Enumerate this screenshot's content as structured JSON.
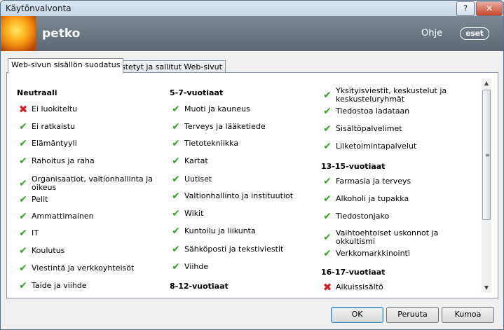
{
  "window": {
    "title": "Käytönvalvonta",
    "help_label": "?",
    "close_label": "✕"
  },
  "header": {
    "user": "petko",
    "help_link": "Ohje",
    "logo_text": "eset"
  },
  "tabs": [
    {
      "label": "Web-sivun sisällön suodatus",
      "active": true
    },
    {
      "label": "Estetyt ja sallitut Web-sivut",
      "active": false
    }
  ],
  "columns": [
    {
      "heading": "Neutraali",
      "items": [
        {
          "label": "Ei luokiteltu",
          "allowed": false
        },
        {
          "label": "Ei ratkaistu",
          "allowed": true
        },
        {
          "label": "Elämäntyyli",
          "allowed": true
        },
        {
          "label": "Rahoitus ja raha",
          "allowed": true
        },
        {
          "label": "Organisaatiot, valtionhallinta ja oikeus",
          "allowed": true
        },
        {
          "label": "Pelit",
          "allowed": true
        },
        {
          "label": "Ammattimainen",
          "allowed": true
        },
        {
          "label": "IT",
          "allowed": true
        },
        {
          "label": "Koulutus",
          "allowed": true
        },
        {
          "label": "Viestintä ja verkkoyhteisöt",
          "allowed": true
        },
        {
          "label": "Taide ja viihde",
          "allowed": true
        }
      ]
    },
    {
      "heading": "5-7-vuotiaat",
      "items": [
        {
          "label": "Muoti ja kauneus",
          "allowed": true
        },
        {
          "label": "Terveys ja lääketiede",
          "allowed": true
        },
        {
          "label": "Tietotekniikka",
          "allowed": true
        },
        {
          "label": "Kartat",
          "allowed": true
        },
        {
          "label": "Uutiset",
          "allowed": true
        },
        {
          "label": "Valtionhallinto ja instituutiot",
          "allowed": true
        },
        {
          "label": "Wikit",
          "allowed": true
        },
        {
          "label": "Kuntoilu ja liikunta",
          "allowed": true
        },
        {
          "label": "Sähköposti ja tekstiviestit",
          "allowed": true
        },
        {
          "label": "Viihde",
          "allowed": true
        }
      ],
      "heading2": "8-12-vuotiaat"
    },
    {
      "items": [
        {
          "label": "Yksityisviestit, keskustelut ja keskusteluryhmät",
          "allowed": true
        },
        {
          "label": "Tiedostoa ladataan",
          "allowed": true
        },
        {
          "label": "Sisältöpalvelimet",
          "allowed": true
        },
        {
          "label": "Liiketoimintapalvelut",
          "allowed": true
        }
      ],
      "heading2": "13-15-vuotiaat",
      "items2": [
        {
          "label": "Farmasia ja terveys",
          "allowed": true
        },
        {
          "label": "Alkoholi ja tupakka",
          "allowed": true
        },
        {
          "label": "Tiedostonjako",
          "allowed": true
        },
        {
          "label": "Vaihtoehtoiset uskonnot ja okkultismi",
          "allowed": true
        },
        {
          "label": "Verkkomarkkinointi",
          "allowed": true
        }
      ],
      "heading3": "16-17-vuotiaat",
      "items3": [
        {
          "label": "Aikuissisältö",
          "allowed": false
        }
      ]
    }
  ],
  "buttons": {
    "ok": "OK",
    "cancel": "Peruuta",
    "undo": "Kumoa"
  },
  "colors": {
    "allowed": "#3aa02c",
    "blocked": "#d32020",
    "header": "#6a7580"
  }
}
